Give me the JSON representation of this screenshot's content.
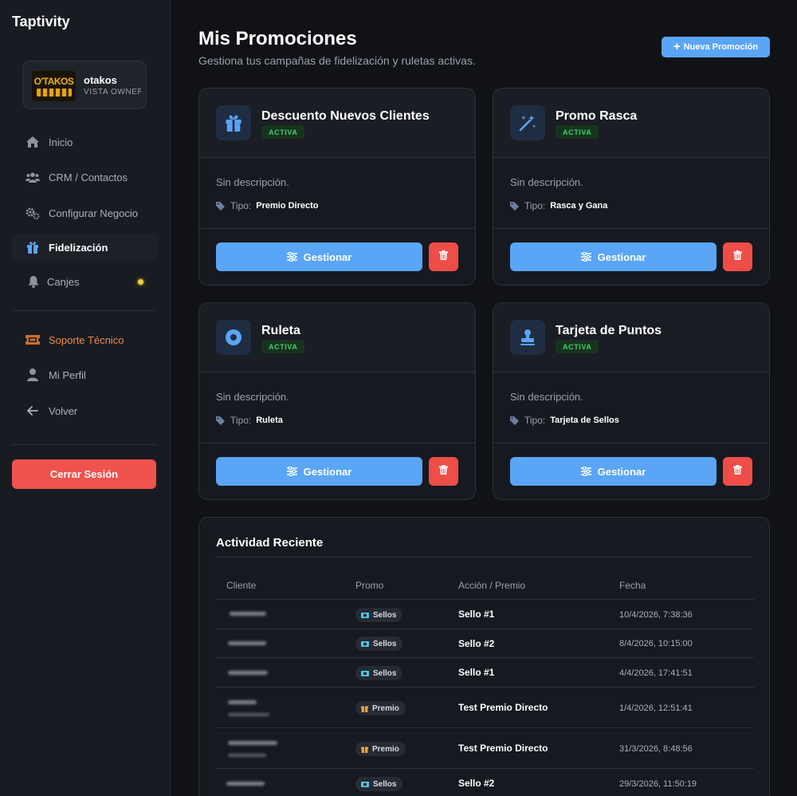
{
  "app": {
    "title": "Taptivity"
  },
  "profile": {
    "name": "otakos",
    "role": "VISTA OWNER",
    "logo_text": "O'TAKOS"
  },
  "nav": {
    "items": [
      {
        "label": "Inicio",
        "icon": "home-icon"
      },
      {
        "label": "CRM / Contactos",
        "icon": "users-icon"
      },
      {
        "label": "Configurar Negocio",
        "icon": "gears-icon"
      },
      {
        "label": "Fidelización",
        "icon": "gift-icon",
        "active": true
      },
      {
        "label": "Canjes",
        "icon": "bell-icon",
        "indicator_color": "#f4d13a"
      }
    ],
    "secondary": [
      {
        "label": "Soporte Técnico",
        "icon": "ticket-icon"
      },
      {
        "label": "Mi Perfil",
        "icon": "user-icon"
      },
      {
        "label": "Volver",
        "icon": "arrow-left-icon"
      }
    ],
    "logout_label": "Cerrar Sesión"
  },
  "header": {
    "title": "Mis Promociones",
    "subtitle": "Gestiona tus campañas de fidelización y ruletas activas.",
    "new_button": "Nueva Promoción"
  },
  "promotions": [
    {
      "title": "Descuento Nuevos Clientes",
      "status": "ACTIVA",
      "description": "Sin descripción.",
      "type_label": "Tipo:",
      "type": "Premio Directo",
      "icon": "gift-icon",
      "manage_label": "Gestionar"
    },
    {
      "title": "Promo Rasca",
      "status": "ACTIVA",
      "description": "Sin descripción.",
      "type_label": "Tipo:",
      "type": "Rasca y Gana",
      "icon": "magic-wand-icon",
      "manage_label": "Gestionar"
    },
    {
      "title": "Ruleta",
      "status": "ACTIVA",
      "description": "Sin descripción.",
      "type_label": "Tipo:",
      "type": "Ruleta",
      "icon": "roulette-icon",
      "manage_label": "Gestionar"
    },
    {
      "title": "Tarjeta de Puntos",
      "status": "ACTIVA",
      "description": "Sin descripción.",
      "type_label": "Tipo:",
      "type": "Tarjeta de Sellos",
      "icon": "stamp-icon",
      "manage_label": "Gestionar"
    }
  ],
  "activity": {
    "title": "Actividad Reciente",
    "columns": [
      "Cliente",
      "Promo",
      "Acción / Premio",
      "Fecha"
    ],
    "rows": [
      {
        "promo": "Sellos",
        "promo_icon": "ticket-icon",
        "action": "Sello #1",
        "date": "10/4/2026, 7:38:36"
      },
      {
        "promo": "Sellos",
        "promo_icon": "ticket-icon",
        "action": "Sello #2",
        "date": "8/4/2026, 10:15:00"
      },
      {
        "promo": "Sellos",
        "promo_icon": "ticket-icon",
        "action": "Sello #1",
        "date": "4/4/2026, 17:41:51"
      },
      {
        "promo": "Premio",
        "promo_icon": "gift-icon",
        "action": "Test Premio Directo",
        "date": "1/4/2026, 12:51:41"
      },
      {
        "promo": "Premio",
        "promo_icon": "gift-icon",
        "action": "Test Premio Directo",
        "date": "31/3/2026, 8:48:56"
      },
      {
        "promo": "Sellos",
        "promo_icon": "ticket-icon",
        "action": "Sello #2",
        "date": "29/3/2026, 11:50:19"
      }
    ]
  },
  "colors": {
    "accent": "#5aa5f5",
    "danger": "#ef4d47",
    "active_badge": "#3fd16a",
    "support": "#f08a4b",
    "background": "#101216"
  }
}
